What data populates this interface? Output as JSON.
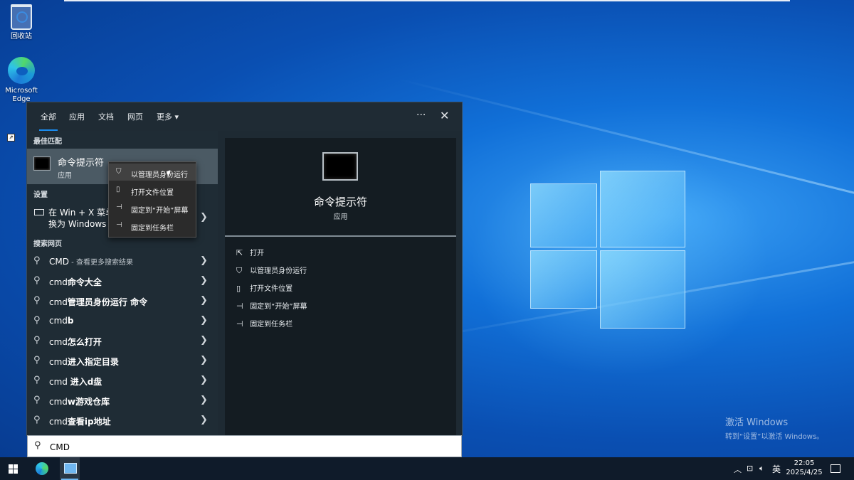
{
  "desktop": {
    "icons": [
      {
        "label": "回收站"
      },
      {
        "label": "Microsoft Edge"
      }
    ],
    "activation": {
      "title": "激活 Windows",
      "subtitle": "转到“设置”以激活 Windows。"
    }
  },
  "search_panel": {
    "tabs": [
      {
        "label": "全部",
        "active": true
      },
      {
        "label": "应用"
      },
      {
        "label": "文档"
      },
      {
        "label": "网页"
      },
      {
        "label": "更多"
      }
    ],
    "more_icon": "more-dots-icon",
    "close_icon": "close-icon",
    "sections": {
      "best_match": "最佳匹配",
      "settings": "设置",
      "web": "搜索网页"
    },
    "best_match": {
      "name": "命令提示符",
      "type": "应用"
    },
    "settings_item": {
      "line1": "在 Win + X 菜单",
      "line2": "换为 Windows"
    },
    "web_results": [
      {
        "prefix": "CMD",
        "bold": "",
        "hint": " - 查看更多搜索结果"
      },
      {
        "prefix": "cmd",
        "bold": "命令大全",
        "hint": ""
      },
      {
        "prefix": "cmd",
        "bold": "管理员身份运行 命令",
        "hint": ""
      },
      {
        "prefix": "cmd",
        "bold": "b",
        "hint": ""
      },
      {
        "prefix": "cmd",
        "bold": "怎么打开",
        "hint": ""
      },
      {
        "prefix": "cmd",
        "bold": "进入指定目录",
        "hint": ""
      },
      {
        "prefix": "cmd ",
        "bold": "进入d盘",
        "hint": ""
      },
      {
        "prefix": "cmd",
        "bold": "w游戏仓库",
        "hint": ""
      },
      {
        "prefix": "cmd",
        "bold": "查看ip地址",
        "hint": ""
      }
    ],
    "preview": {
      "name": "命令提示符",
      "type": "应用",
      "actions": [
        {
          "label": "打开",
          "icon": "open-icon"
        },
        {
          "label": "以管理员身份运行",
          "icon": "shield-icon"
        },
        {
          "label": "打开文件位置",
          "icon": "folder-icon"
        },
        {
          "label": "固定到“开始”屏幕",
          "icon": "pin-icon"
        },
        {
          "label": "固定到任务栏",
          "icon": "pin-icon"
        }
      ]
    }
  },
  "context_menu": {
    "items": [
      {
        "label": "以管理员身份运行",
        "icon": "shield-icon",
        "highlighted": true
      },
      {
        "label": "打开文件位置",
        "icon": "folder-icon"
      },
      {
        "label": "固定到“开始”屏幕",
        "icon": "pin-icon"
      },
      {
        "label": "固定到任务栏",
        "icon": "pin-icon"
      }
    ]
  },
  "search_box": {
    "value": "CMD"
  },
  "taskbar": {
    "ime": "英",
    "time": "22:05",
    "date": "2025/4/25"
  },
  "colors": {
    "accent": "#1a8cf0",
    "panel": "#1e2a33",
    "preview": "#141c22"
  }
}
